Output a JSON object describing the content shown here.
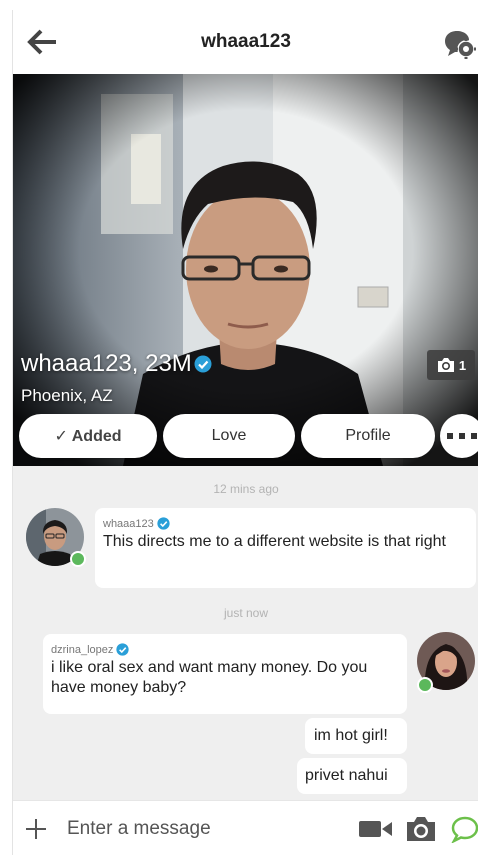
{
  "header": {
    "title": "whaaa123"
  },
  "profile": {
    "name_age": "whaaa123, 23M",
    "location": "Phoenix, AZ",
    "photo_count": "1"
  },
  "actions": {
    "added_label": "✓ Added",
    "love_label": "Love",
    "profile_label": "Profile"
  },
  "chat": {
    "messages": [
      {
        "timestamp": "12 mins ago",
        "sender": "whaaa123",
        "texts": [
          "This directs me to a different website is that right"
        ]
      },
      {
        "timestamp": "just now",
        "sender": "dzrina_lopez",
        "texts": [
          "i like oral sex and want many money. Do you have money baby?",
          "im hot girl!",
          "privet nahui"
        ]
      }
    ]
  },
  "composer": {
    "placeholder": "Enter a message"
  },
  "colors": {
    "verified": "#2a9fd8",
    "online": "#5cb85c",
    "send": "#6cc04a"
  },
  "icons": [
    "back-arrow-icon",
    "chat-settings-icon",
    "camera-icon",
    "more-dots-icon",
    "plus-icon",
    "video-icon",
    "send-chat-icon"
  ]
}
